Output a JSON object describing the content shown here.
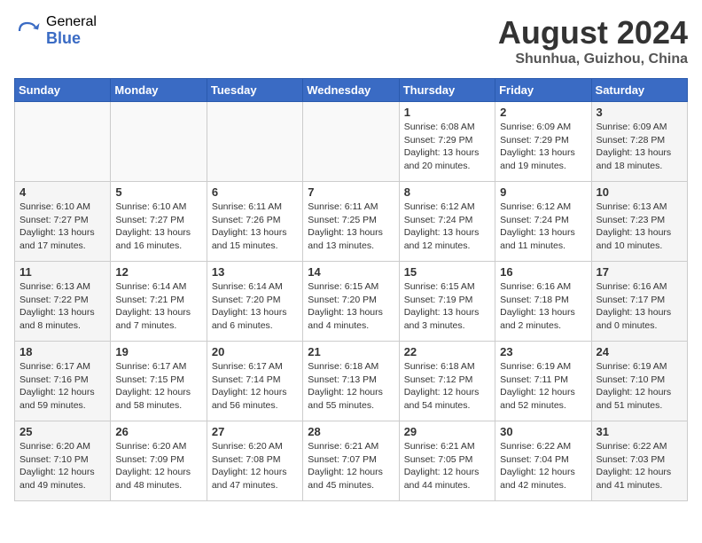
{
  "header": {
    "logo_general": "General",
    "logo_blue": "Blue",
    "month_year": "August 2024",
    "location": "Shunhua, Guizhou, China"
  },
  "weekdays": [
    "Sunday",
    "Monday",
    "Tuesday",
    "Wednesday",
    "Thursday",
    "Friday",
    "Saturday"
  ],
  "weeks": [
    [
      {
        "day": "",
        "info": ""
      },
      {
        "day": "",
        "info": ""
      },
      {
        "day": "",
        "info": ""
      },
      {
        "day": "",
        "info": ""
      },
      {
        "day": "1",
        "info": "Sunrise: 6:08 AM\nSunset: 7:29 PM\nDaylight: 13 hours\nand 20 minutes."
      },
      {
        "day": "2",
        "info": "Sunrise: 6:09 AM\nSunset: 7:29 PM\nDaylight: 13 hours\nand 19 minutes."
      },
      {
        "day": "3",
        "info": "Sunrise: 6:09 AM\nSunset: 7:28 PM\nDaylight: 13 hours\nand 18 minutes."
      }
    ],
    [
      {
        "day": "4",
        "info": "Sunrise: 6:10 AM\nSunset: 7:27 PM\nDaylight: 13 hours\nand 17 minutes."
      },
      {
        "day": "5",
        "info": "Sunrise: 6:10 AM\nSunset: 7:27 PM\nDaylight: 13 hours\nand 16 minutes."
      },
      {
        "day": "6",
        "info": "Sunrise: 6:11 AM\nSunset: 7:26 PM\nDaylight: 13 hours\nand 15 minutes."
      },
      {
        "day": "7",
        "info": "Sunrise: 6:11 AM\nSunset: 7:25 PM\nDaylight: 13 hours\nand 13 minutes."
      },
      {
        "day": "8",
        "info": "Sunrise: 6:12 AM\nSunset: 7:24 PM\nDaylight: 13 hours\nand 12 minutes."
      },
      {
        "day": "9",
        "info": "Sunrise: 6:12 AM\nSunset: 7:24 PM\nDaylight: 13 hours\nand 11 minutes."
      },
      {
        "day": "10",
        "info": "Sunrise: 6:13 AM\nSunset: 7:23 PM\nDaylight: 13 hours\nand 10 minutes."
      }
    ],
    [
      {
        "day": "11",
        "info": "Sunrise: 6:13 AM\nSunset: 7:22 PM\nDaylight: 13 hours\nand 8 minutes."
      },
      {
        "day": "12",
        "info": "Sunrise: 6:14 AM\nSunset: 7:21 PM\nDaylight: 13 hours\nand 7 minutes."
      },
      {
        "day": "13",
        "info": "Sunrise: 6:14 AM\nSunset: 7:20 PM\nDaylight: 13 hours\nand 6 minutes."
      },
      {
        "day": "14",
        "info": "Sunrise: 6:15 AM\nSunset: 7:20 PM\nDaylight: 13 hours\nand 4 minutes."
      },
      {
        "day": "15",
        "info": "Sunrise: 6:15 AM\nSunset: 7:19 PM\nDaylight: 13 hours\nand 3 minutes."
      },
      {
        "day": "16",
        "info": "Sunrise: 6:16 AM\nSunset: 7:18 PM\nDaylight: 13 hours\nand 2 minutes."
      },
      {
        "day": "17",
        "info": "Sunrise: 6:16 AM\nSunset: 7:17 PM\nDaylight: 13 hours\nand 0 minutes."
      }
    ],
    [
      {
        "day": "18",
        "info": "Sunrise: 6:17 AM\nSunset: 7:16 PM\nDaylight: 12 hours\nand 59 minutes."
      },
      {
        "day": "19",
        "info": "Sunrise: 6:17 AM\nSunset: 7:15 PM\nDaylight: 12 hours\nand 58 minutes."
      },
      {
        "day": "20",
        "info": "Sunrise: 6:17 AM\nSunset: 7:14 PM\nDaylight: 12 hours\nand 56 minutes."
      },
      {
        "day": "21",
        "info": "Sunrise: 6:18 AM\nSunset: 7:13 PM\nDaylight: 12 hours\nand 55 minutes."
      },
      {
        "day": "22",
        "info": "Sunrise: 6:18 AM\nSunset: 7:12 PM\nDaylight: 12 hours\nand 54 minutes."
      },
      {
        "day": "23",
        "info": "Sunrise: 6:19 AM\nSunset: 7:11 PM\nDaylight: 12 hours\nand 52 minutes."
      },
      {
        "day": "24",
        "info": "Sunrise: 6:19 AM\nSunset: 7:10 PM\nDaylight: 12 hours\nand 51 minutes."
      }
    ],
    [
      {
        "day": "25",
        "info": "Sunrise: 6:20 AM\nSunset: 7:10 PM\nDaylight: 12 hours\nand 49 minutes."
      },
      {
        "day": "26",
        "info": "Sunrise: 6:20 AM\nSunset: 7:09 PM\nDaylight: 12 hours\nand 48 minutes."
      },
      {
        "day": "27",
        "info": "Sunrise: 6:20 AM\nSunset: 7:08 PM\nDaylight: 12 hours\nand 47 minutes."
      },
      {
        "day": "28",
        "info": "Sunrise: 6:21 AM\nSunset: 7:07 PM\nDaylight: 12 hours\nand 45 minutes."
      },
      {
        "day": "29",
        "info": "Sunrise: 6:21 AM\nSunset: 7:05 PM\nDaylight: 12 hours\nand 44 minutes."
      },
      {
        "day": "30",
        "info": "Sunrise: 6:22 AM\nSunset: 7:04 PM\nDaylight: 12 hours\nand 42 minutes."
      },
      {
        "day": "31",
        "info": "Sunrise: 6:22 AM\nSunset: 7:03 PM\nDaylight: 12 hours\nand 41 minutes."
      }
    ]
  ]
}
